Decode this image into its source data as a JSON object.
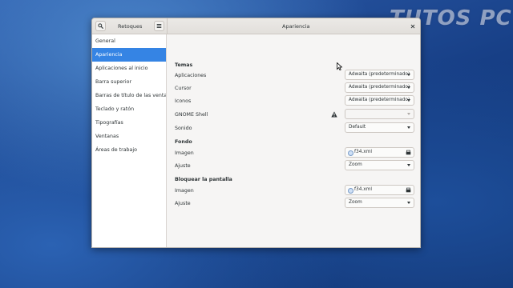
{
  "watermark": "TUTOS PC",
  "window": {
    "sidebar_title": "Retoques",
    "title": "Apariencia"
  },
  "sidebar": {
    "items": [
      {
        "label": "General"
      },
      {
        "label": "Apariencia",
        "active": true
      },
      {
        "label": "Aplicaciones al inicio"
      },
      {
        "label": "Barra superior"
      },
      {
        "label": "Barras de título de las ventanas"
      },
      {
        "label": "Teclado y ratón"
      },
      {
        "label": "Tipografías"
      },
      {
        "label": "Ventanas"
      },
      {
        "label": "Áreas de trabajo"
      }
    ]
  },
  "temas": {
    "heading": "Temas",
    "aplicaciones": {
      "label": "Aplicaciones",
      "value": "Adwaita (predeterminado)"
    },
    "cursor": {
      "label": "Cursor",
      "value": "Adwaita (predeterminado)"
    },
    "iconos": {
      "label": "Iconos",
      "value": "Adwaita (predeterminado)"
    },
    "shell": {
      "label": "GNOME Shell",
      "value": ""
    },
    "sonido": {
      "label": "Sonido",
      "value": "Default"
    }
  },
  "fondo": {
    "heading": "Fondo",
    "imagen": {
      "label": "Imagen",
      "value": "f34.xml"
    },
    "ajuste": {
      "label": "Ajuste",
      "value": "Zoom"
    }
  },
  "bloqueo": {
    "heading": "Bloquear la pantalla",
    "imagen": {
      "label": "Imagen",
      "value": "f34.xml"
    },
    "ajuste": {
      "label": "Ajuste",
      "value": "Zoom"
    }
  },
  "colors": {
    "accent": "#3584e4",
    "window_bg": "#f6f5f4",
    "sidebar_bg": "#ffffff",
    "text": "#2e3436"
  },
  "icons": [
    "search-icon",
    "menu-icon",
    "close-icon",
    "warning-icon",
    "file-icon",
    "file-chooser-icon",
    "chevron-down-icon",
    "mouse-pointer-icon"
  ]
}
